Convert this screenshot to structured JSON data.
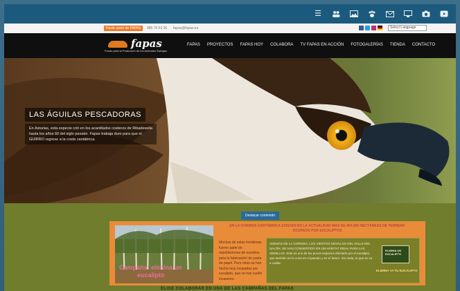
{
  "topbar": {
    "icons": [
      "list-icon",
      "users-icon",
      "image-icon",
      "paw-icon",
      "envelope-icon",
      "monitor-icon",
      "camera-icon",
      "video-icon"
    ]
  },
  "utility": {
    "button_label": "Hazte socio de FAPAS",
    "phone": "985 76 53 36",
    "email": "fapas@fapas.es",
    "language_select": "Select Language"
  },
  "logo": {
    "word": "fapas",
    "tagline": "Fondo para la Protección de los Animales Salvajes"
  },
  "nav": {
    "items": [
      "FAPAS",
      "PROYECTOS",
      "FAPAS HOY",
      "COLABORA",
      "TV FAPAS EN ACCIÓN",
      "FOTOGALERÍAS",
      "TIENDA",
      "CONTACTO"
    ]
  },
  "hero": {
    "title": "LAS ÁGUILAS PESCADORAS",
    "text": "En Asturias, esta especie crió en los acantilados costeros de Ribadesella hasta los años 60 del siglo pasado. Fapas trabaja duro para que el GUIRRO regrese a la costa cantábrica."
  },
  "lower": {
    "cta_label": "Destacar contenido",
    "card_heading": "EN LA CORNISA CANTÁBRICA EXISTEN EN LA ACTUALIDAD MÁS DE 400.000 HECTÁREAS DE TERRENO OCUPADO POR EUCALIPTOS",
    "photo_caption_1": "Campaña: elimina un",
    "photo_caption_2": "eucalipto",
    "mid_text": "Muchas de estas hectáreas, fueron parte de repoblaciones de nuestros para la fabricación de pasta de papel. Pero otras se han hecho muy ocupadas por eucalipto, que se han vuelto invasores.",
    "box_text": "ADEMÁS DE LA CORNISA, LOS VIENTOS NOVILLOS DEL VALLE DEL NALÓN, SE HAN CONVERTIDO EN UN HÁBITAT IDEAL PARA LAS SEMILLAS. Este es uno de los pocos espacios afectado por el eucalipto, que también en la zona en el pasado y en el futuro. Sin duda, lo que se va a cuidar.",
    "box_thumb": "ELIMINA UN EUCALIPTO",
    "box_link": "ELIMINA YA TU EUCALIPTO",
    "bottom_heading": "ELIGE COLABORAR EN UNA DE LAS CAMPAÑAS DEL FAPAS"
  },
  "colors": {
    "topbar": "#1b5a7c",
    "nav_bg": "#0f0f0f",
    "accent_orange": "#e97d2f",
    "olive": "#6f7d2c"
  }
}
